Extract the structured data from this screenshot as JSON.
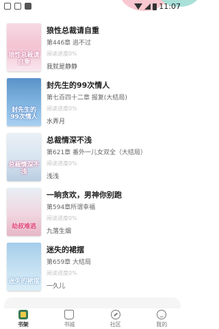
{
  "status_bar": {
    "time": "11:07"
  },
  "books": [
    {
      "title": "狼性总裁请自重",
      "chapter": "第446章  逃不过",
      "progress": "阅读进度0%",
      "author": "我就是静静",
      "cover_text": "狼性总裁请自重"
    },
    {
      "title": "封先生的99次情人",
      "chapter": "第七百四十二章 报复(大结局)",
      "progress": "阅读进度0%",
      "author": "水弄月",
      "cover_text": "封先生的99次情人"
    },
    {
      "title": "总裁情深不浅",
      "chapter": "第621章 番外一儿女双全（大结局）",
      "progress": "阅读进度0%",
      "author": "浅浅",
      "cover_text": "总裁情深不浅"
    },
    {
      "title": "一晌贪欢，男神你别跑",
      "chapter": "第594章所谓幸福",
      "progress": "阅读进度0%",
      "author": "九落生烟",
      "cover_text": "劫叔难逃"
    },
    {
      "title": "迷失的裙摆",
      "chapter": "第659章  大结局",
      "progress": "阅读进度0%",
      "author": "一久儿",
      "cover_text": "迷失的裙摆"
    }
  ],
  "tabs": [
    {
      "label": "书架",
      "icon": "bookshelf-icon",
      "active": true
    },
    {
      "label": "书城",
      "icon": "bookstore-icon",
      "active": false
    },
    {
      "label": "社区",
      "icon": "community-icon",
      "active": false
    },
    {
      "label": "我的",
      "icon": "profile-icon",
      "active": false
    }
  ]
}
